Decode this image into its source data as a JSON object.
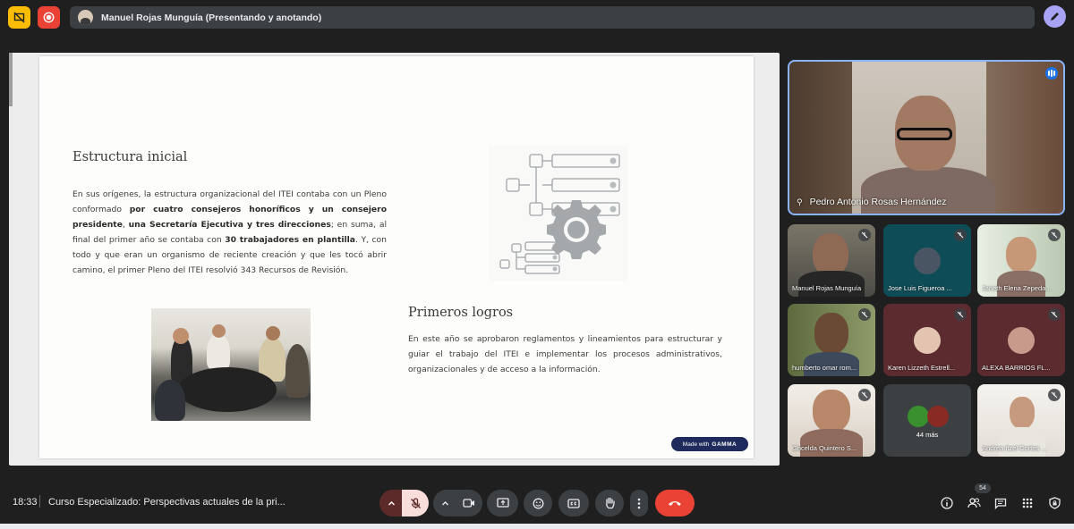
{
  "presenter_bar": {
    "text": "Manuel Rojas Munguía (Presentando y anotando)"
  },
  "slide": {
    "section1_title": "Estructura inicial",
    "section1_text_html": "En sus orígenes, la estructura organizacional del ITEI contaba con un Pleno conformado <b>por cuatro consejeros honoríficos y un consejero presidente</b>, <b>una Secretaría Ejecutiva y tres direcciones</b>; en suma, al final del primer año se contaba con <b>30 trabajadores en plantilla</b>. Y, con todo y que eran un organismo de reciente creación y que les tocó abrir camino, el primer Pleno del ITEI resolvió 343 Recursos de Revisión.",
    "section2_title": "Primeros logros",
    "section2_text": "En este año se aprobaron reglamentos y lineamientos para estructurar y guiar el trabajo del ITEI e implementar los procesos administrativos, organizacionales y de acceso a la información.",
    "badge_prefix": "Made with",
    "badge_brand": "GAMMA"
  },
  "main_participant": {
    "name": "Pedro Antonio Rosas Hernández"
  },
  "participants": [
    {
      "name": "Manuel Rojas Munguía"
    },
    {
      "name": "Jose Luis Figueroa ..."
    },
    {
      "name": "Janeth Elena Zepeda..."
    },
    {
      "name": "humberto omar rom..."
    },
    {
      "name": "Karen Lizzeth Estrell..."
    },
    {
      "name": "ALEXA BARRIOS FL..."
    },
    {
      "name": "Gricelda Quintero S..."
    },
    {
      "name": "44 más"
    },
    {
      "name": "Andrea Itzel Cortes ..."
    }
  ],
  "bottom": {
    "time": "18:33",
    "meeting_title": "Curso Especializado: Perspectivas actuales de la pri...",
    "participant_count": "54"
  },
  "colors": {
    "end_call": "#ea4335",
    "accent_blue": "#8ab4f8",
    "mic_muted": "#f9dedc"
  }
}
